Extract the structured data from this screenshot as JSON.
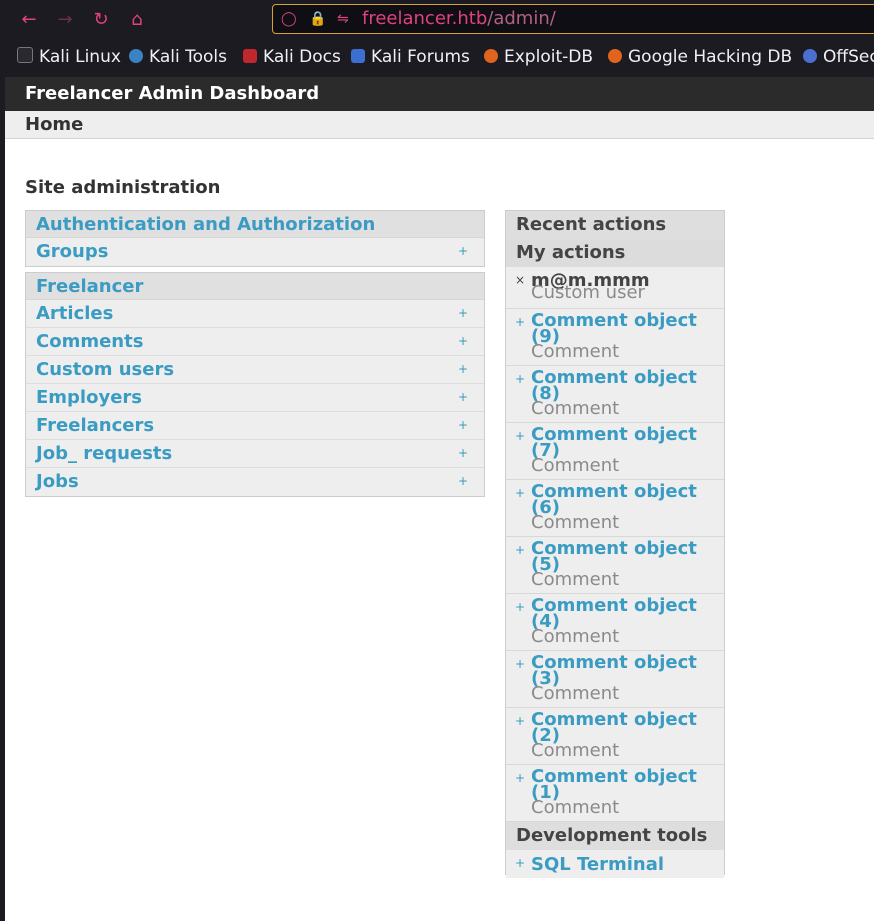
{
  "browser": {
    "url_host": "freelancer.htb",
    "url_path": "/admin/",
    "bookmarks": [
      {
        "label": "Kali Linux",
        "icon": "kali-dragon-icon",
        "color": "#1c1b22"
      },
      {
        "label": "Kali Tools",
        "icon": "kali-tools-icon",
        "color": "#3b82c4"
      },
      {
        "label": "Kali Docs",
        "icon": "kali-docs-icon",
        "color": "#c0282d"
      },
      {
        "label": "Kali Forums",
        "icon": "kali-forums-icon",
        "color": "#3b6fd1"
      },
      {
        "label": "Exploit-DB",
        "icon": "exploit-db-icon",
        "color": "#e0641e"
      },
      {
        "label": "Google Hacking DB",
        "icon": "ghdb-icon",
        "color": "#e0641e"
      },
      {
        "label": "OffSec",
        "icon": "offsec-icon",
        "color": "#4a6fd1"
      }
    ]
  },
  "header": {
    "title": "Freelancer Admin Dashboard"
  },
  "breadcrumb": {
    "home": "Home"
  },
  "page": {
    "heading": "Site administration"
  },
  "apps": [
    {
      "caption": "Authentication and Authorization",
      "models": [
        {
          "name": "Groups",
          "add": "+"
        }
      ]
    },
    {
      "caption": "Freelancer",
      "models": [
        {
          "name": "Articles",
          "add": "+"
        },
        {
          "name": "Comments",
          "add": "+"
        },
        {
          "name": "Custom users",
          "add": "+"
        },
        {
          "name": "Employers",
          "add": "+"
        },
        {
          "name": "Freelancers",
          "add": "+"
        },
        {
          "name": "Job_ requests",
          "add": "+"
        },
        {
          "name": "Jobs",
          "add": "+"
        }
      ]
    }
  ],
  "recent": {
    "title": "Recent actions",
    "my_actions": "My actions",
    "items": [
      {
        "mark": "×",
        "title": "m@m.mmm",
        "type": "Custom user"
      },
      {
        "mark": "+",
        "title": "Comment object (9)",
        "type": "Comment"
      },
      {
        "mark": "+",
        "title": "Comment object (8)",
        "type": "Comment"
      },
      {
        "mark": "+",
        "title": "Comment object (7)",
        "type": "Comment"
      },
      {
        "mark": "+",
        "title": "Comment object (6)",
        "type": "Comment"
      },
      {
        "mark": "+",
        "title": "Comment object (5)",
        "type": "Comment"
      },
      {
        "mark": "+",
        "title": "Comment object (4)",
        "type": "Comment"
      },
      {
        "mark": "+",
        "title": "Comment object (3)",
        "type": "Comment"
      },
      {
        "mark": "+",
        "title": "Comment object (2)",
        "type": "Comment"
      },
      {
        "mark": "+",
        "title": "Comment object (1)",
        "type": "Comment"
      }
    ],
    "dev_tools_title": "Development tools",
    "dev_tools": [
      {
        "mark": "+",
        "label": "SQL Terminal"
      }
    ]
  },
  "colors": {
    "link": "#3a9bc3",
    "header_bg": "#2b2b2b",
    "accent": "#e0437c"
  }
}
